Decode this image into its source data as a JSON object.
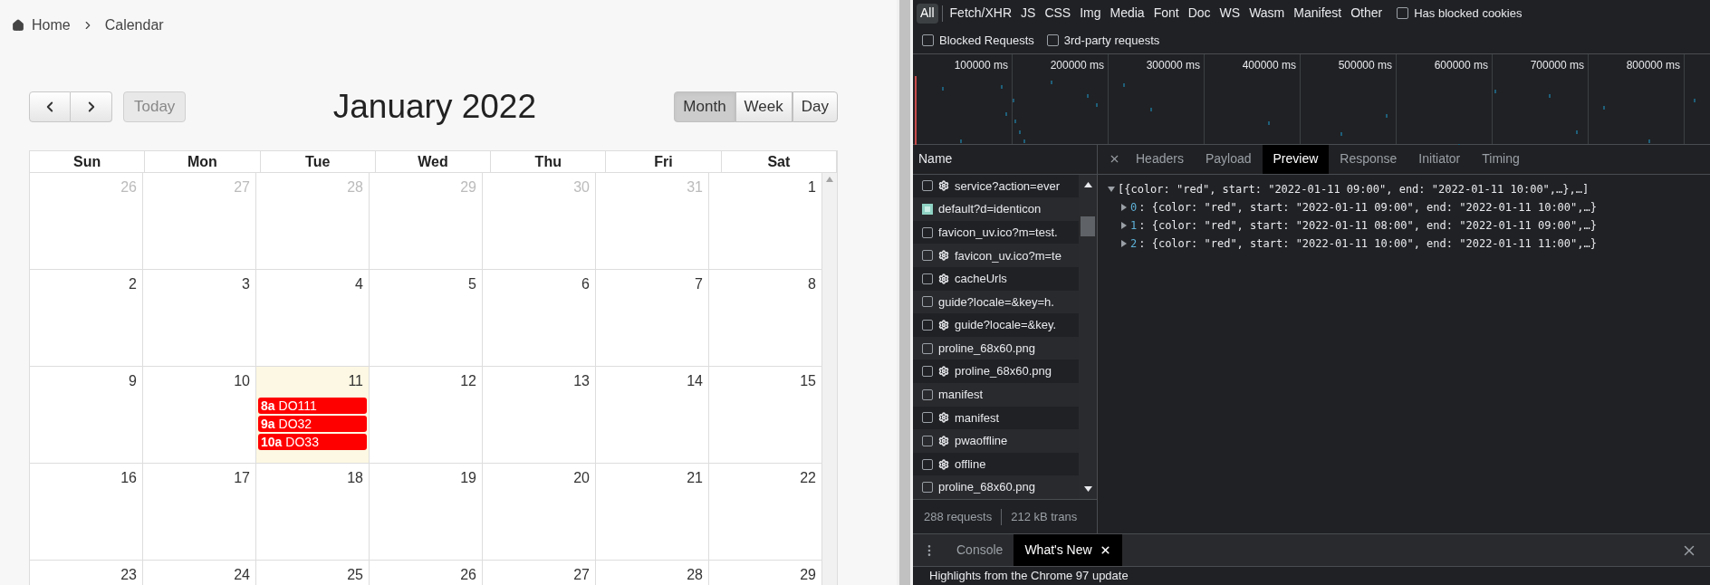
{
  "breadcrumb": [
    {
      "label": "Home"
    },
    {
      "label": "Calendar"
    }
  ],
  "calendar": {
    "title": "January 2022",
    "today_button": {
      "label": "Today",
      "disabled": true
    },
    "views": [
      {
        "label": "Month",
        "selected": true
      },
      {
        "label": "Week",
        "selected": false
      },
      {
        "label": "Day",
        "selected": false
      }
    ],
    "weekdays": [
      "Sun",
      "Mon",
      "Tue",
      "Wed",
      "Thu",
      "Fri",
      "Sat"
    ],
    "weeks": [
      [
        {
          "day": "26",
          "other_month": true,
          "today": false
        },
        {
          "day": "27",
          "other_month": true,
          "today": false
        },
        {
          "day": "28",
          "other_month": true,
          "today": false
        },
        {
          "day": "29",
          "other_month": true,
          "today": false
        },
        {
          "day": "30",
          "other_month": true,
          "today": false
        },
        {
          "day": "31",
          "other_month": true,
          "today": false
        },
        {
          "day": "1",
          "other_month": false,
          "today": false
        }
      ],
      [
        {
          "day": "2",
          "other_month": false,
          "today": false
        },
        {
          "day": "3",
          "other_month": false,
          "today": false
        },
        {
          "day": "4",
          "other_month": false,
          "today": false
        },
        {
          "day": "5",
          "other_month": false,
          "today": false
        },
        {
          "day": "6",
          "other_month": false,
          "today": false
        },
        {
          "day": "7",
          "other_month": false,
          "today": false
        },
        {
          "day": "8",
          "other_month": false,
          "today": false
        }
      ],
      [
        {
          "day": "9",
          "other_month": false,
          "today": false
        },
        {
          "day": "10",
          "other_month": false,
          "today": false
        },
        {
          "day": "11",
          "other_month": false,
          "today": true,
          "events": [
            {
              "time": "8a",
              "title": "DO111",
              "color": "#ff0000"
            },
            {
              "time": "9a",
              "title": "DO32",
              "color": "#ff0000"
            },
            {
              "time": "10a",
              "title": "DO33",
              "color": "#ff0000"
            }
          ]
        },
        {
          "day": "12",
          "other_month": false,
          "today": false
        },
        {
          "day": "13",
          "other_month": false,
          "today": false
        },
        {
          "day": "14",
          "other_month": false,
          "today": false
        },
        {
          "day": "15",
          "other_month": false,
          "today": false
        }
      ],
      [
        {
          "day": "16",
          "other_month": false,
          "today": false
        },
        {
          "day": "17",
          "other_month": false,
          "today": false
        },
        {
          "day": "18",
          "other_month": false,
          "today": false
        },
        {
          "day": "19",
          "other_month": false,
          "today": false
        },
        {
          "day": "20",
          "other_month": false,
          "today": false
        },
        {
          "day": "21",
          "other_month": false,
          "today": false
        },
        {
          "day": "22",
          "other_month": false,
          "today": false
        }
      ],
      [
        {
          "day": "23",
          "other_month": false,
          "today": false
        },
        {
          "day": "24",
          "other_month": false,
          "today": false
        },
        {
          "day": "25",
          "other_month": false,
          "today": false
        },
        {
          "day": "26",
          "other_month": false,
          "today": false
        },
        {
          "day": "27",
          "other_month": false,
          "today": false
        },
        {
          "day": "28",
          "other_month": false,
          "today": false
        },
        {
          "day": "29",
          "other_month": false,
          "today": false
        }
      ]
    ]
  },
  "devtools": {
    "filters": [
      {
        "label": "All",
        "selected": true
      },
      {
        "label": "Fetch/XHR",
        "selected": false
      },
      {
        "label": "JS",
        "selected": false
      },
      {
        "label": "CSS",
        "selected": false
      },
      {
        "label": "Img",
        "selected": false
      },
      {
        "label": "Media",
        "selected": false
      },
      {
        "label": "Font",
        "selected": false
      },
      {
        "label": "Doc",
        "selected": false
      },
      {
        "label": "WS",
        "selected": false
      },
      {
        "label": "Wasm",
        "selected": false
      },
      {
        "label": "Manifest",
        "selected": false
      },
      {
        "label": "Other",
        "selected": false
      }
    ],
    "checkboxes_row1": [
      {
        "label": "Has blocked cookies",
        "checked": false
      }
    ],
    "checkboxes_row2": [
      {
        "label": "Blocked Requests",
        "checked": false
      },
      {
        "label": "3rd-party requests",
        "checked": false
      }
    ],
    "timeline_ticks": [
      "100000 ms",
      "200000 ms",
      "300000 ms",
      "400000 ms",
      "500000 ms",
      "600000 ms",
      "700000 ms",
      "800000 ms"
    ],
    "name_header": "Name",
    "requests": [
      {
        "name": "service?action=ever",
        "kind": "file",
        "gear": true,
        "checked": false
      },
      {
        "name": "default?d=identicon",
        "kind": "image",
        "gear": false
      },
      {
        "name": "favicon_uv.ico?m=test.",
        "kind": "file",
        "gear": false,
        "checked": false
      },
      {
        "name": "favicon_uv.ico?m=te",
        "kind": "file",
        "gear": true,
        "checked": false
      },
      {
        "name": "cacheUrls",
        "kind": "file",
        "gear": true,
        "checked": false
      },
      {
        "name": "guide?locale=&key=h.",
        "kind": "file",
        "gear": false,
        "checked": false
      },
      {
        "name": "guide?locale=&key.",
        "kind": "file",
        "gear": true,
        "checked": false
      },
      {
        "name": "proline_68x60.png",
        "kind": "file",
        "gear": false,
        "checked": false
      },
      {
        "name": "proline_68x60.png",
        "kind": "file",
        "gear": true,
        "checked": false
      },
      {
        "name": "manifest",
        "kind": "file",
        "gear": false,
        "checked": false
      },
      {
        "name": "manifest",
        "kind": "file",
        "gear": true,
        "checked": false
      },
      {
        "name": "pwaoffline",
        "kind": "file",
        "gear": true,
        "checked": false
      },
      {
        "name": "offline",
        "kind": "file",
        "gear": true,
        "checked": false
      },
      {
        "name": "proline_68x60.png",
        "kind": "file",
        "gear": false,
        "checked": false
      }
    ],
    "summary": [
      {
        "text": "288 requests"
      },
      {
        "text": "212 kB trans"
      }
    ],
    "detail_tabs": [
      {
        "label": "Headers",
        "selected": false
      },
      {
        "label": "Payload",
        "selected": false
      },
      {
        "label": "Preview",
        "selected": true
      },
      {
        "label": "Response",
        "selected": false
      },
      {
        "label": "Initiator",
        "selected": false
      },
      {
        "label": "Timing",
        "selected": false
      }
    ],
    "preview": {
      "root": {
        "text": "[{color: \"red\", start: \"2022-01-11 09:00\", end: \"2022-01-11 10:00\",…},…]",
        "expanded": true
      },
      "items": [
        {
          "index": "0",
          "text": ": {color: \"red\", start: \"2022-01-11 09:00\", end: \"2022-01-11 10:00\",…}",
          "expanded": false
        },
        {
          "index": "1",
          "text": ": {color: \"red\", start: \"2022-01-11 08:00\", end: \"2022-01-11 09:00\",…}",
          "expanded": false
        },
        {
          "index": "2",
          "text": ": {color: \"red\", start: \"2022-01-11 10:00\", end: \"2022-01-11 11:00\",…}",
          "expanded": false
        }
      ]
    },
    "drawer_tabs": [
      {
        "label": "Console",
        "selected": false
      },
      {
        "label": "What's New",
        "selected": true
      }
    ],
    "drawer_text": "Highlights from the Chrome 97 update"
  }
}
